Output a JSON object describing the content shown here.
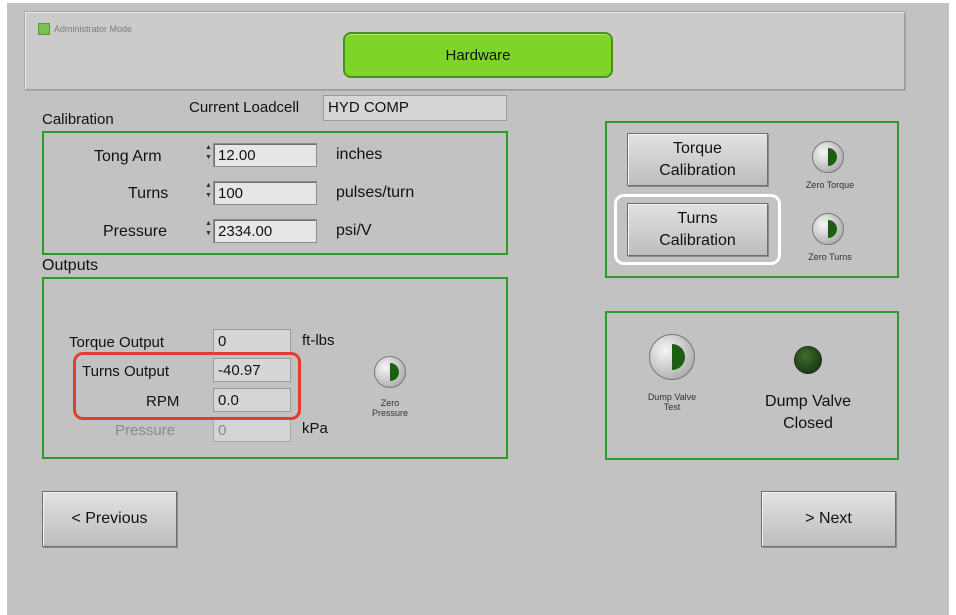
{
  "header": {
    "admin_mode": "Administrator Mode",
    "title_button": "Hardware"
  },
  "calibration": {
    "section_label": "Calibration",
    "loadcell_label": "Current Loadcell",
    "loadcell_value": "HYD COMP",
    "rows": [
      {
        "label": "Tong Arm",
        "value": "12.00",
        "unit": "inches"
      },
      {
        "label": "Turns",
        "value": "100",
        "unit": "pulses/turn"
      },
      {
        "label": "Pressure",
        "value": "2334.00",
        "unit": "psi/V"
      }
    ]
  },
  "outputs": {
    "section_label": "Outputs",
    "torque": {
      "label": "Torque Output",
      "value": "0",
      "unit": "ft-lbs"
    },
    "turns": {
      "label": "Turns Output",
      "value": "-40.97"
    },
    "rpm": {
      "label": "RPM",
      "value": "0.0"
    },
    "pressure": {
      "label": "Pressure",
      "value": "0",
      "unit": "kPa"
    },
    "zero_pressure_label": "Zero Pressure"
  },
  "calibration_buttons": {
    "torque_button": "Torque Calibration",
    "turns_button": "Turns Calibration",
    "zero_torque_label": "Zero Torque",
    "zero_turns_label": "Zero Turns"
  },
  "dump_valve": {
    "test_label": "Dump Valve Test",
    "status_line1": "Dump Valve",
    "status_line2": "Closed"
  },
  "nav": {
    "previous": "<   Previous",
    "next": ">   Next"
  },
  "colors": {
    "accent_green": "#7fd42a",
    "group_border": "#2e9a2e",
    "highlight_red": "#e53a2f"
  }
}
